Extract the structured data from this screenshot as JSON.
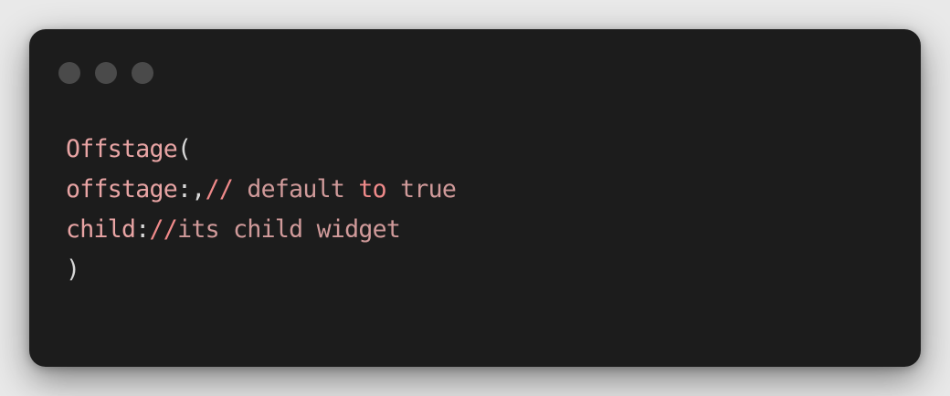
{
  "colors": {
    "page_background": "#e9e9e9",
    "window_background": "#1c1c1c",
    "traffic_light": "#4a4a4a",
    "identifier": "#e8a4a4",
    "keyword": "#f08a8a",
    "punctuation": "#d7d7d7",
    "comment": "#d09a9a"
  },
  "code": {
    "line1": {
      "ident": "Offstage",
      "punct": "("
    },
    "line2": {
      "ident": "offstage",
      "punct": ":,",
      "slashes": "//",
      "comment_a": " default ",
      "kw": "to",
      "comment_b": " true"
    },
    "line3": {
      "ident": "child",
      "punct": ":",
      "slashes": "//",
      "comment": "its child widget"
    },
    "line4": {
      "punct": ")"
    }
  }
}
